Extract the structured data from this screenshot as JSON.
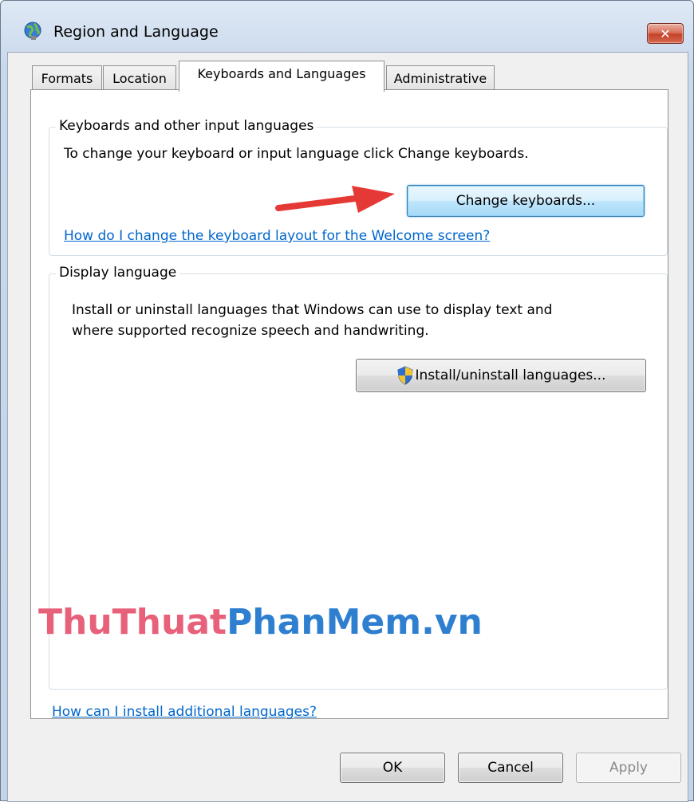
{
  "window": {
    "title": "Region and Language",
    "close_label": "✕"
  },
  "tabs": [
    {
      "label": "Formats",
      "active": false
    },
    {
      "label": "Location",
      "active": false
    },
    {
      "label": "Keyboards and Languages",
      "active": true
    },
    {
      "label": "Administrative",
      "active": false
    }
  ],
  "keyboards_group": {
    "title": "Keyboards and other input languages",
    "description": "To change your keyboard or input language click Change keyboards.",
    "change_button": "Change keyboards...",
    "welcome_link": "How do I change the keyboard layout for the Welcome screen?"
  },
  "display_group": {
    "title": "Display language",
    "description_line1": "Install or uninstall languages that Windows can use to display text and",
    "description_line2": "where supported recognize speech and handwriting.",
    "install_button": "Install/uninstall languages..."
  },
  "additional_link": "How can I install additional languages?",
  "footer": {
    "ok": "OK",
    "cancel": "Cancel",
    "apply": "Apply"
  },
  "watermark": {
    "part1": "ThuThuat",
    "part2": "PhanMem.vn"
  },
  "colors": {
    "link": "#0066cc",
    "arrow": "#e53935",
    "watermark_pink": "#e8617a",
    "watermark_blue": "#2f7fd0"
  },
  "icons": [
    "globe-icon",
    "close-icon",
    "uac-shield-icon"
  ]
}
